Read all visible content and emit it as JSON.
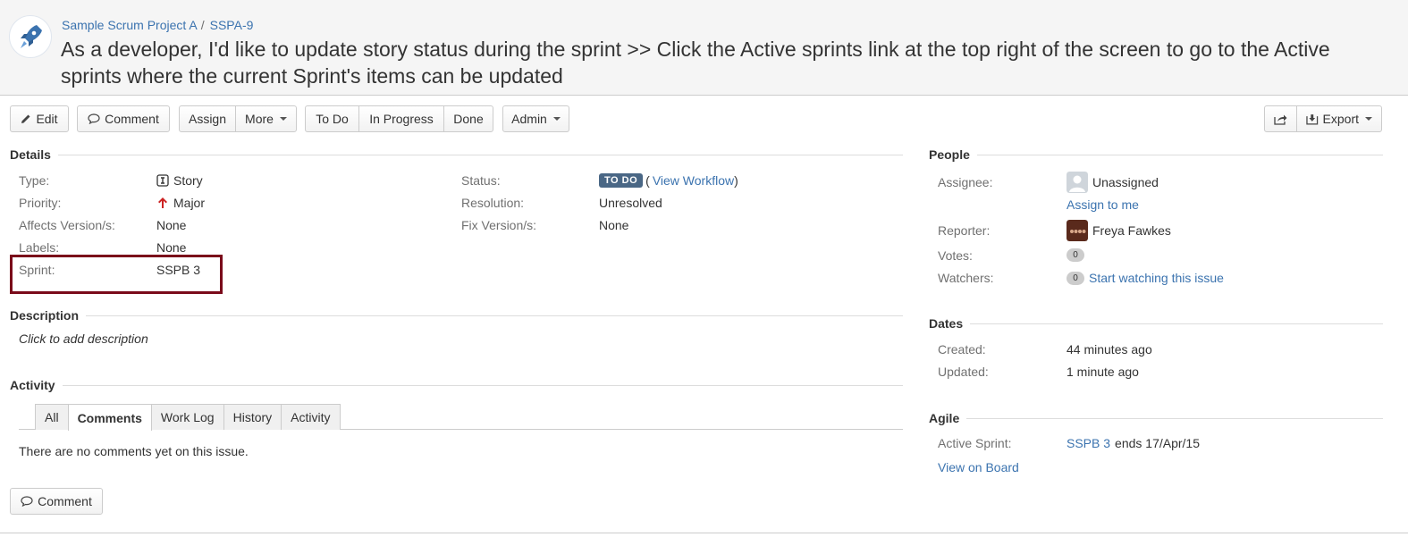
{
  "header": {
    "breadcrumb_project": "Sample Scrum Project A",
    "breadcrumb_sep": "/",
    "breadcrumb_issue": "SSPA-9",
    "summary": "As a developer, I'd like to update story status during the sprint >> Click the Active sprints link at the top right of the screen to go to the Active sprints where the current Sprint's items can be updated"
  },
  "toolbar": {
    "edit": "Edit",
    "comment": "Comment",
    "assign": "Assign",
    "more": "More",
    "todo": "To Do",
    "in_progress": "In Progress",
    "done": "Done",
    "admin": "Admin",
    "export": "Export"
  },
  "details": {
    "heading": "Details",
    "type_label": "Type:",
    "type_value": "Story",
    "priority_label": "Priority:",
    "priority_value": "Major",
    "affects_label": "Affects Version/s:",
    "affects_value": "None",
    "labels_label": "Labels:",
    "labels_value": "None",
    "sprint_label": "Sprint:",
    "sprint_value": "SSPB 3",
    "status_label": "Status:",
    "status_value": "TO DO",
    "workflow_open": "(",
    "workflow_link": "View Workflow",
    "workflow_close": ")",
    "resolution_label": "Resolution:",
    "resolution_value": "Unresolved",
    "fix_label": "Fix Version/s:",
    "fix_value": "None"
  },
  "description": {
    "heading": "Description",
    "placeholder": "Click to add description"
  },
  "activity": {
    "heading": "Activity",
    "tabs": [
      "All",
      "Comments",
      "Work Log",
      "History",
      "Activity"
    ],
    "active_tab": "Comments",
    "empty_text": "There are no comments yet on this issue.",
    "comment_button": "Comment"
  },
  "people": {
    "heading": "People",
    "assignee_label": "Assignee:",
    "assignee_value": "Unassigned",
    "assign_to_me": "Assign to me",
    "reporter_label": "Reporter:",
    "reporter_value": "Freya Fawkes",
    "votes_label": "Votes:",
    "votes_count": "0",
    "watchers_label": "Watchers:",
    "watchers_count": "0",
    "watch_link": "Start watching this issue"
  },
  "dates": {
    "heading": "Dates",
    "created_label": "Created:",
    "created_value": "44 minutes ago",
    "updated_label": "Updated:",
    "updated_value": "1 minute ago"
  },
  "agile": {
    "heading": "Agile",
    "active_sprint_label": "Active Sprint:",
    "sprint_link": "SSPB 3",
    "sprint_ends": "ends 17/Apr/15",
    "view_on_board": "View on Board"
  },
  "colors": {
    "link": "#3b73af",
    "status_lozenge": "#4a6785",
    "highlight_box": "#7a0a1a",
    "priority_arrow": "#cc2222"
  }
}
